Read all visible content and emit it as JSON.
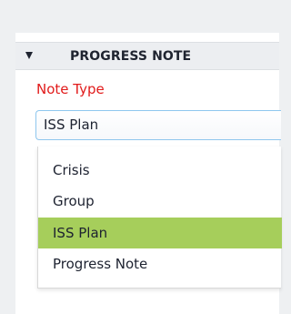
{
  "section": {
    "title": "PROGRESS NOTE",
    "toggle_icon": "collapse-triangle-icon"
  },
  "field": {
    "label": "Note Type",
    "selected_value": "ISS Plan"
  },
  "dropdown": {
    "options": [
      {
        "label": "Crisis",
        "selected": false
      },
      {
        "label": "Group",
        "selected": false
      },
      {
        "label": "ISS Plan",
        "selected": true
      },
      {
        "label": "Progress Note",
        "selected": false
      }
    ]
  },
  "colors": {
    "label_required": "#e11b1b",
    "selected_highlight": "#a6ce5b",
    "focus_border": "#8fc7ee"
  }
}
